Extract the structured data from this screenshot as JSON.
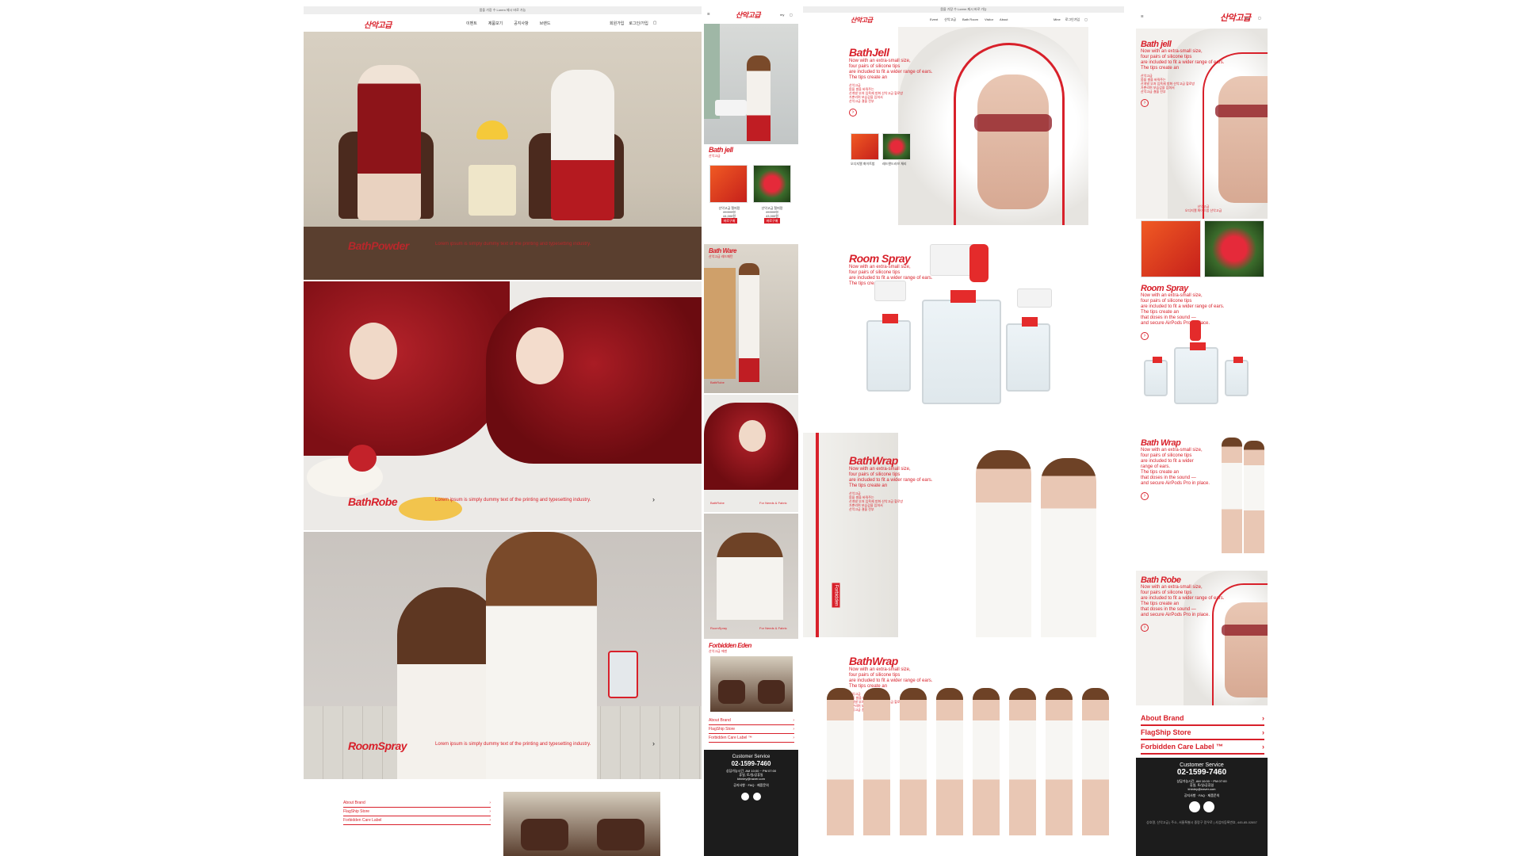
{
  "colors": {
    "accent": "#d8202a",
    "dark": "#1c1c1c"
  },
  "logo_text": "산악고급",
  "desktop": {
    "topbar": "몸을 가장 수 Lorem 제시 바로 가능",
    "nav": [
      "이벤트",
      "제품보기",
      "공지사항",
      "브랜드"
    ],
    "util": [
      "회원가입",
      "로그인/가입",
      "bag-icon"
    ],
    "sections": [
      {
        "title": "BathPowder",
        "desc": "Lorem ipsum is simply dummy text of the printing and typesetting industry."
      },
      {
        "title": "BathRobe",
        "desc": "Lorem ipsum is simply dummy text of the printing and typesetting industry."
      },
      {
        "title": "RoomSpray",
        "desc": "Lorem ipsum is simply dummy text of the printing and typesetting industry."
      }
    ],
    "footer_links": [
      "About Brand",
      "FlagShip Store",
      "Forbidden Care Label"
    ]
  },
  "mobile1": {
    "bathjell_title": "Bath jell",
    "bathjell_sub": "산악고급",
    "products": [
      {
        "name": "산악고급 철피망",
        "price1": "49,500원",
        "price2": "44,000원",
        "badge": "바로구매"
      },
      {
        "name": "산악고급 철피망",
        "price1": "49,500원",
        "price2": "43,000원",
        "badge": "바로구매"
      }
    ],
    "bathware_title": "Bath Ware",
    "bathware_sub": "산악고급 레드패턴",
    "caption1": "BathRobe",
    "caption2": "RoomSpray",
    "caption_right": "For Needs & Fabric",
    "eden_title": "Forbidden Eden",
    "eden_sub": "산악고급 에덴",
    "links": [
      "About Brand",
      "FlagShip Store",
      "Forbidden Care Label ™"
    ],
    "footer": {
      "title": "Customer Service",
      "phone": "02-1599-7460",
      "hours": "상담가능시간, AM 10:00 ~ PM 07:00",
      "days": "휴일, 토/일/공휴일",
      "email": "khinley@naver.com",
      "bottom": "공지사항 · FAQ · 제품문의"
    }
  },
  "desktop2": {
    "nav": [
      "Event",
      "산악고급",
      "Bath Room",
      "Visitor",
      "About"
    ],
    "util": [
      "Mine",
      "로그인가입"
    ],
    "bathjell": {
      "title": "BathJell",
      "lines": [
        "Now with an extra-small size,",
        "four pairs of silicone tips",
        "are included to fit a wider range of ears.",
        "The tips create an"
      ],
      "ko": [
        "산악고급",
        "몸을 쌀을 바꿔주는",
        "산개발 부처 입욕제 방화 산악고급 할로방",
        "가뿐리며 보습감을 입혀서",
        "산악고급 결을 전부"
      ],
      "thumbs": [
        "오디지엘 화이트밤",
        "레드앤드러브 체리"
      ]
    },
    "roomspray": {
      "title": "Room Spray",
      "lines": [
        "Now with an extra-small size,",
        "four pairs of silicone tips",
        "are included to fit a wider range of ears.",
        "The tips create an"
      ]
    },
    "bathwrap1": {
      "title": "BathWrap",
      "lines": [
        "Now with an extra-small size,",
        "four pairs of silicone tips",
        "are included to fit a wider range of ears.",
        "The tips create an"
      ],
      "ko": [
        "산악고급",
        "몸을 쌀을 바꿔주는",
        "산개발 부처 입욕제 방화 산악고급 할로방",
        "가뿐리며 보습감을 입혀서",
        "산악고급 결을 전부"
      ],
      "tag": "Forbidden"
    },
    "bathwrap2": {
      "title": "BathWrap",
      "lines": [
        "Now with an extra-small size,",
        "four pairs of silicone tips",
        "are included to fit a wider range of ears.",
        "The tips create an"
      ],
      "ko": [
        "산악고급",
        "몸을 쌀을 바꿔주는",
        "산개발 부처 입욕제 방화 산악고급 할로방",
        "가뿐리며 보습감을 입혀서",
        "산악고급 결을 전부"
      ]
    }
  },
  "mobile2": {
    "util": "my",
    "bathjell": {
      "title": "Bath jell",
      "lines": [
        "Now with an extra-small size,",
        "four pairs of silicone tips",
        "are included to fit a wider range of ears.",
        "The tips create an"
      ],
      "ko": [
        "산악고급",
        "몸을 쌀을 바꿔주는",
        "산개발 부처 입욕제 방화 산악고급 할로방",
        "가뿐리며 보습감을 입혀서",
        "산악고급 결을 전부"
      ]
    },
    "product_caption": [
      "산악고급",
      "오디지엘 화이트밤 산악고급"
    ],
    "roomspray": {
      "title": "Room Spray",
      "lines": [
        "Now with an extra-small size,",
        "four pairs of silicone tips",
        "are included to fit a wider range of ears.",
        "The tips create an",
        "that doses in the sound —",
        "and secure AirPods Pro in place."
      ]
    },
    "bathwrap": {
      "title": "Bath Wrap",
      "lines": [
        "Now with an extra-small size,",
        "four pairs of silicone tips",
        "are included to fit a wider",
        "range of ears.",
        "The tips create an",
        "that doses in the sound —",
        "and secure AirPods Pro in place."
      ]
    },
    "bathrobe": {
      "title": "Bath Robe",
      "lines": [
        "Now with an extra-small size,",
        "four pairs of silicone tips",
        "are included to fit a wider range of ears.",
        "The tips create an",
        "that doses in the sound —",
        "and secure AirPods Pro in place."
      ]
    },
    "links": [
      "About Brand",
      "FlagShip Store",
      "Forbidden Care Label ™"
    ],
    "footer": {
      "title": "Customer Service",
      "phone": "02-1599-7460",
      "hours": "상담가능시간, AM 10:00 ~ PM 07:00",
      "days": "휴일, 토/일/공휴일",
      "email": "khinley@naver.com",
      "links": "공지사항 · FAQ · 제품문의",
      "legal": "상호명, 산악고급 | 주소, 서울특별시 중랑구 망우로 | 사업자등록번호, 445-85-02657"
    }
  }
}
